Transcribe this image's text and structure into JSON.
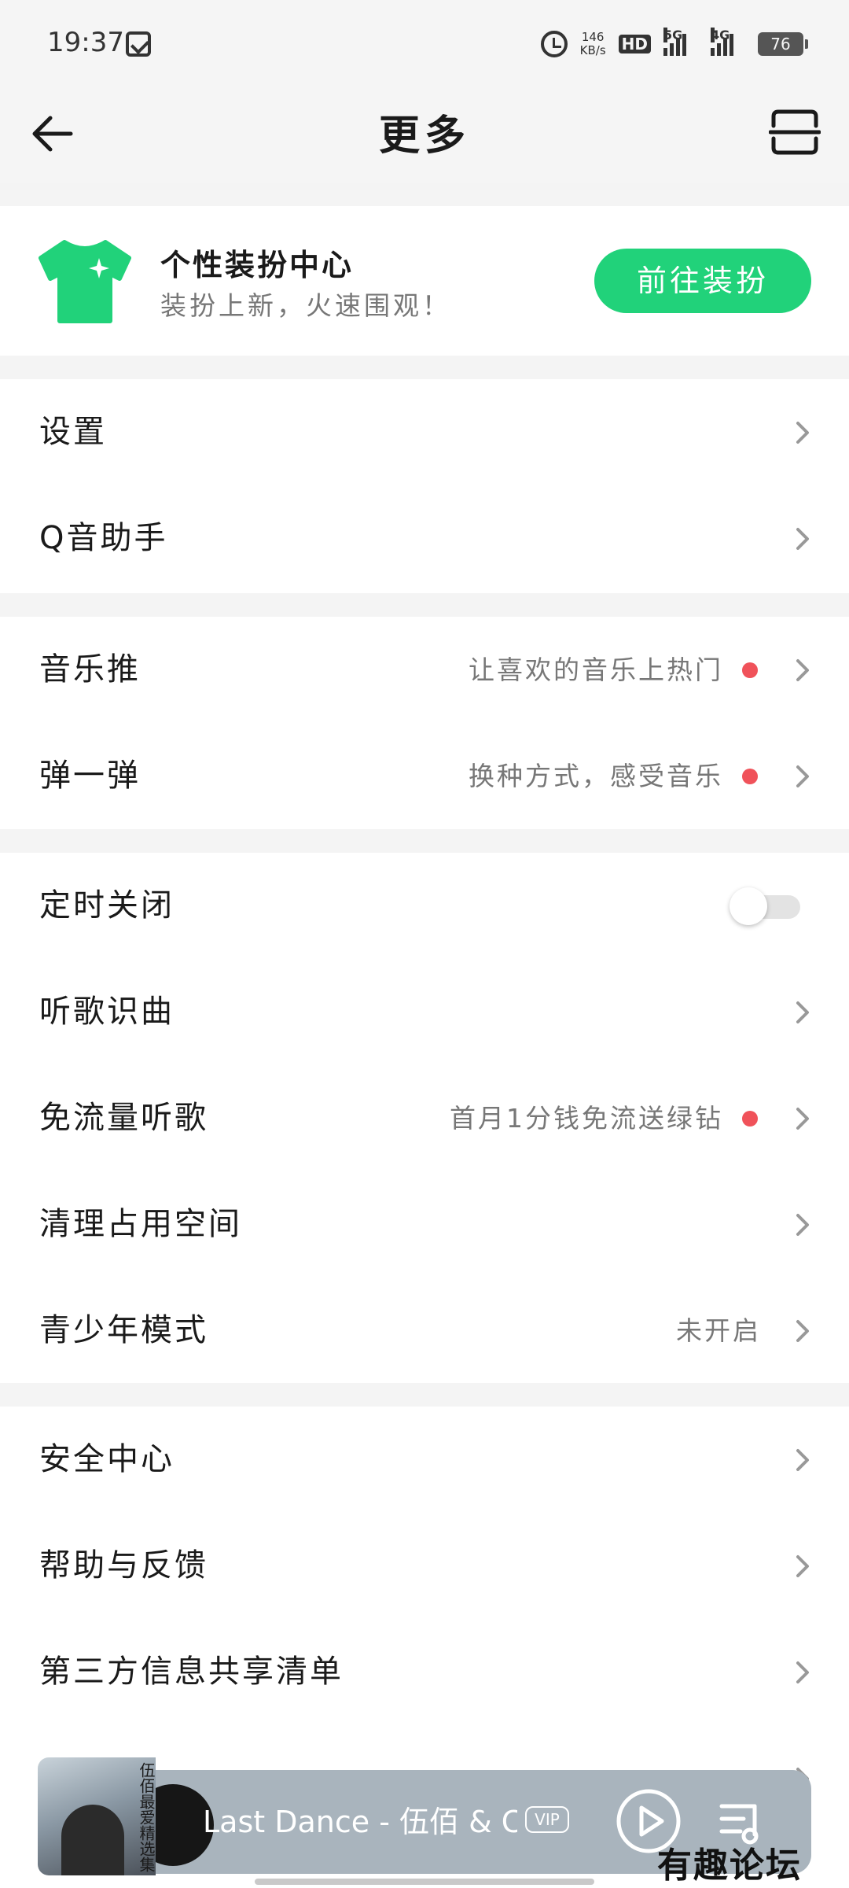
{
  "status_bar": {
    "time": "19:37",
    "speed_value": "146",
    "speed_unit": "KB/s",
    "hd_label": "HD",
    "net_5g": "5G",
    "net_4g": "4G",
    "battery": "76"
  },
  "header": {
    "title": "更多"
  },
  "promo": {
    "title": "个性装扮中心",
    "subtitle": "装扮上新，火速围观！",
    "button_label": "前往装扮",
    "accent_color": "#21d27a"
  },
  "sections": [
    {
      "items": [
        {
          "label": "设置",
          "sub": "",
          "dot": false
        },
        {
          "label": "Q音助手",
          "sub": "",
          "dot": false
        }
      ]
    },
    {
      "items": [
        {
          "label": "音乐推",
          "sub": "让喜欢的音乐上热门",
          "dot": true
        },
        {
          "label": "弹一弹",
          "sub": "换种方式，感受音乐",
          "dot": true
        }
      ]
    },
    {
      "items": [
        {
          "label": "定时关闭",
          "toggle": true,
          "toggle_on": false
        },
        {
          "label": "听歌识曲",
          "sub": "",
          "dot": false
        },
        {
          "label": "免流量听歌",
          "sub": "首月1分钱免流送绿钻",
          "dot": true
        },
        {
          "label": "清理占用空间",
          "sub": "",
          "dot": false
        },
        {
          "label": "青少年模式",
          "sub": "未开启",
          "dot": false
        }
      ]
    },
    {
      "items": [
        {
          "label": "安全中心",
          "sub": "",
          "dot": false
        },
        {
          "label": "帮助与反馈",
          "sub": "",
          "dot": false
        },
        {
          "label": "第三方信息共享清单",
          "sub": "",
          "dot": false
        }
      ]
    }
  ],
  "player": {
    "track": "Last Dance - 伍佰 & Ch",
    "vip_label": "VIP",
    "album_text": "伍佰最爱精选集"
  },
  "watermark": "有趣论坛"
}
